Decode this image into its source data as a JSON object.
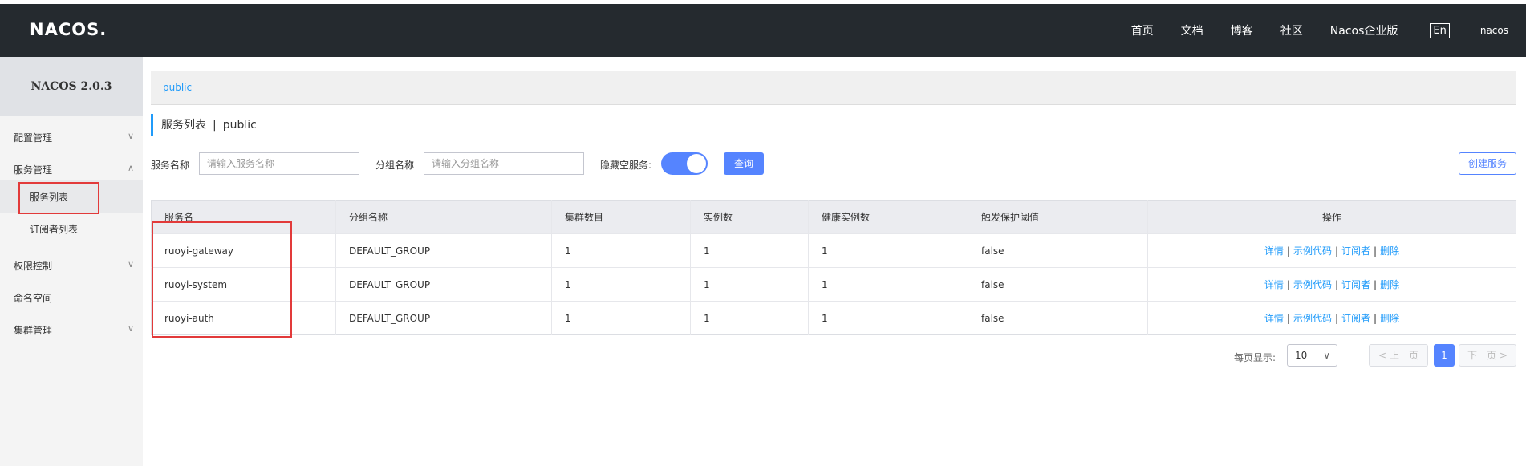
{
  "header": {
    "logo": "NACOS.",
    "nav": [
      "首页",
      "文档",
      "博客",
      "社区",
      "Nacos企业版"
    ],
    "lang": "En",
    "user": "nacos"
  },
  "sidebar": {
    "version": "NACOS 2.0.3",
    "items": [
      {
        "label": "配置管理",
        "chevron": "chevron-down-icon"
      },
      {
        "label": "服务管理",
        "chevron": "chevron-up-icon"
      },
      {
        "label": "服务列表"
      },
      {
        "label": "订阅者列表"
      },
      {
        "label": "权限控制",
        "chevron": "chevron-down-icon"
      },
      {
        "label": "命名空间"
      },
      {
        "label": "集群管理",
        "chevron": "chevron-down-icon"
      }
    ]
  },
  "breadcrumb": "public",
  "title": {
    "main": "服务列表",
    "sep": "|",
    "namespace": "public"
  },
  "filters": {
    "service_label": "服务名称",
    "service_placeholder": "请输入服务名称",
    "group_label": "分组名称",
    "group_placeholder": "请输入分组名称",
    "hide_empty_label": "隐藏空服务:",
    "hide_empty_on": true,
    "query_button": "查询",
    "create_button": "创建服务"
  },
  "table": {
    "headers": [
      "服务名",
      "分组名称",
      "集群数目",
      "实例数",
      "健康实例数",
      "触发保护阈值",
      "操作"
    ],
    "rows": [
      [
        "ruoyi-gateway",
        "DEFAULT_GROUP",
        "1",
        "1",
        "1",
        "false"
      ],
      [
        "ruoyi-system",
        "DEFAULT_GROUP",
        "1",
        "1",
        "1",
        "false"
      ],
      [
        "ruoyi-auth",
        "DEFAULT_GROUP",
        "1",
        "1",
        "1",
        "false"
      ]
    ],
    "actions": [
      "详情",
      "示例代码",
      "订阅者",
      "删除"
    ]
  },
  "pagination": {
    "page_size_label": "每页显示:",
    "page_size": "10",
    "prev": "上一页",
    "next": "下一页",
    "current": "1"
  },
  "colors": {
    "accent": "#5584ff",
    "link": "#209bfa",
    "topbar": "#252a2f",
    "highlight_box": "#e23a3a"
  }
}
